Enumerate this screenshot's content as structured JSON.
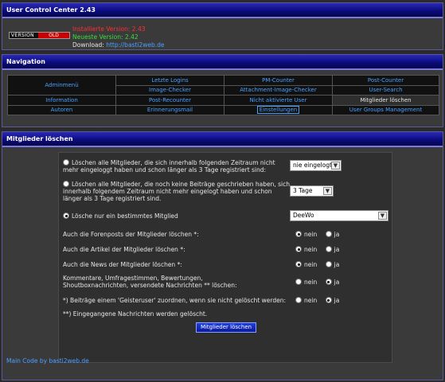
{
  "version_panel": {
    "title": "User Control Center 2.43",
    "logo": {
      "left": "VERSION",
      "right": "OLD"
    },
    "installed": "Installierte Version: 2.43",
    "latest": "Neueste Version: 2.42",
    "download_label": "Download:",
    "download_link": "http://basti2web.de"
  },
  "nav_panel": {
    "title": "Navigation",
    "rows": [
      [
        "",
        "Letzte Logins",
        "PM-Counter",
        "Post-Counter"
      ],
      [
        "Adminmenü",
        "Image-Checker",
        "Attachment-Image-Checker",
        "User-Search"
      ],
      [
        "Information",
        "Post-Recounter",
        "Nicht aktivierte User",
        "Mitglieder löschen"
      ],
      [
        "Autoren",
        "Erinnerungsmail",
        "Einstellungen",
        "User Groups Management"
      ]
    ]
  },
  "delete_panel": {
    "title": "Mitglieder löschen",
    "option1": {
      "label": "Löschen alle Mitglieder, die sich innerhalb folgenden Zeitraum nicht mehr eingeloggt haben und schon länger als 3 Tage registriert sind:",
      "select": "nie eingelogt"
    },
    "option2": {
      "label": "Löschen alle Mitglieder, die noch keine Beiträge geschrieben haben, sich innerhalb folgendem Zeitraum nicht mehr eingelogt haben und schon länger als 3 Tage registriert sind.",
      "select": "3 Tage"
    },
    "option3": {
      "label": "Lösche nur ein bestimmtes Mitglied",
      "select": "DeeWo"
    },
    "questions": [
      {
        "label": "Auch die Forenposts der Mitglieder löschen *:",
        "no": "nein",
        "yes": "ja",
        "selected": "nein"
      },
      {
        "label": "Auch die Artikel der Mitglieder löschen *:",
        "no": "nein",
        "yes": "ja",
        "selected": "nein"
      },
      {
        "label": "Auch die News der Mitglieder löschen *:",
        "no": "nein",
        "yes": "ja",
        "selected": "nein"
      },
      {
        "label": "Kommentare, Umfragestimmen, Bewertungen, Shoutboxnachrichten, versendete Nachrichten ** löschen:",
        "no": "nein",
        "yes": "ja",
        "selected": "ja"
      },
      {
        "label": "*) Beiträge einem 'Geisteruser' zuordnen, wenn sie nicht gelöscht werden:",
        "no": "nein",
        "yes": "ja",
        "selected": "ja"
      }
    ],
    "note": "**) Eingegangene Nachrichten werden gelöscht.",
    "submit": "Mitglieder löschen",
    "footer": "Main Code by basti2web.de"
  }
}
